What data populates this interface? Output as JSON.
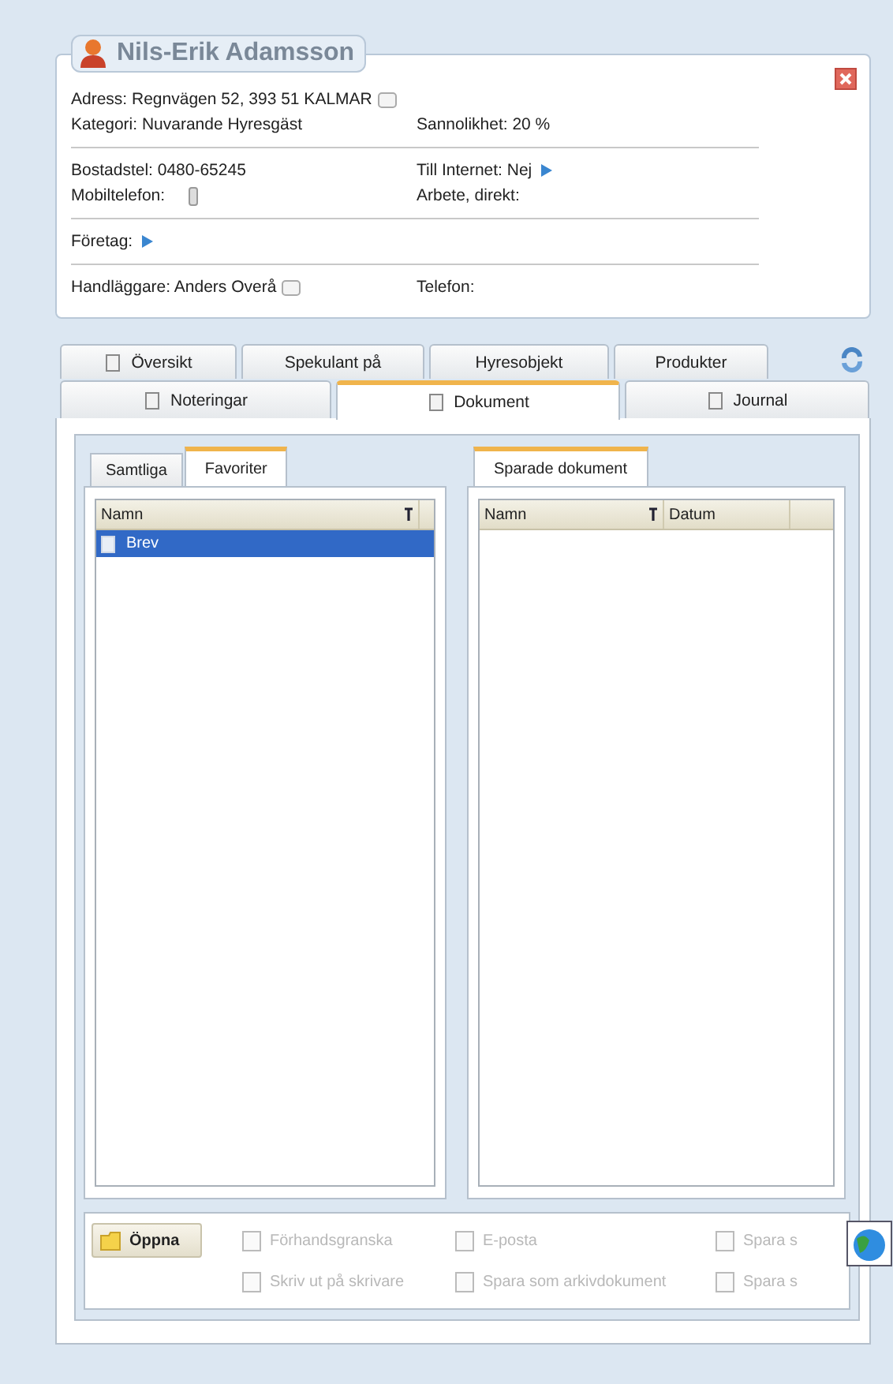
{
  "contact": {
    "name": "Nils-Erik Adamsson",
    "sections": [
      [
        [
          {
            "text": "Adress: Regnvägen 52, 393 51  KALMAR",
            "kind": "card"
          }
        ],
        [
          {
            "text": "Kategori: Nuvarande Hyresgäst",
            "kind": "text"
          },
          {
            "text": "Sannolikhet: 20 %",
            "kind": "text"
          }
        ]
      ],
      [
        [
          {
            "text": "Bostadstel: 0480-65245",
            "kind": "text"
          },
          {
            "text": "Till Internet: Nej",
            "kind": "link"
          }
        ],
        [
          {
            "text": "Mobiltelefon:",
            "kind": "phone"
          },
          {
            "text": "Arbete, direkt:",
            "kind": "text"
          }
        ]
      ],
      [
        [
          {
            "text": "Företag:",
            "kind": "link"
          }
        ]
      ],
      [
        [
          {
            "text": "Handläggare: Anders Overå",
            "kind": "card"
          },
          {
            "text": "Telefon:",
            "kind": "text"
          }
        ]
      ]
    ]
  },
  "tab_rows": [
    [
      {
        "label": "Översikt",
        "kind": "iconed",
        "selected": false
      },
      {
        "label": "Spekulant på",
        "kind": "plain",
        "selected": false
      },
      {
        "label": "Hyresobjekt",
        "kind": "plain",
        "selected": false
      },
      {
        "label": "Produkter",
        "kind": "plain",
        "selected": false
      }
    ],
    [
      {
        "label": "Noteringar",
        "kind": "iconed",
        "selected": false
      },
      {
        "label": "Dokument",
        "kind": "iconed",
        "selected": true
      },
      {
        "label": "Journal",
        "kind": "iconed",
        "selected": false
      }
    ]
  ],
  "left_panel": {
    "tabs": [
      {
        "label": "Samtliga",
        "selected": false
      },
      {
        "label": "Favoriter",
        "selected": true
      }
    ],
    "columns": [
      {
        "label": "Namn",
        "sorted": true
      }
    ],
    "rows": [
      {
        "name": "Brev",
        "selected": true
      }
    ]
  },
  "right_panel": {
    "tabs": [
      {
        "label": "Sparade dokument",
        "selected": true
      }
    ],
    "columns": [
      {
        "label": "Namn",
        "sorted": true
      },
      {
        "label": "Datum",
        "sorted": false
      }
    ]
  },
  "toolbar": {
    "top": [
      {
        "label": "Öppna",
        "disabled": false
      },
      {
        "label": "Förhandsgranska",
        "disabled": true
      },
      {
        "label": "E-posta",
        "disabled": true
      },
      {
        "label": "Spara s",
        "disabled": true
      }
    ],
    "bottom": [
      {
        "label": "Skriv ut på skrivare",
        "disabled": true
      },
      {
        "label": "Spara som arkivdokument",
        "disabled": true
      },
      {
        "label": "Spara s",
        "disabled": true
      }
    ]
  }
}
